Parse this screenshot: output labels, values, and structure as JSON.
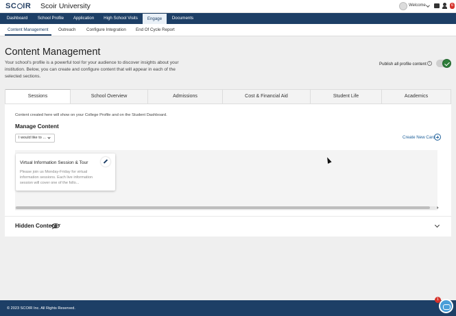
{
  "header": {
    "logo": "SCOIR",
    "org_name": "Scoir University",
    "welcome": "Welcome",
    "notification_count": "6"
  },
  "main_nav": [
    "Dashboard",
    "School Profile",
    "Application",
    "High School Visits",
    "Engage",
    "Documents"
  ],
  "main_nav_active": "Engage",
  "sub_nav": [
    "Content Management",
    "Outreach",
    "Configure Integration",
    "End Of Cycle Report"
  ],
  "sub_nav_active": "Content Management",
  "page": {
    "title": "Content Management",
    "intro": "Your school's profile is a powerful tool for your audience to discover insights about your institution. Below, you can create and configure content that will appear in each of the selected sections.",
    "publish_label": "Publish all profile content",
    "publish_enabled": true
  },
  "content_tabs": [
    "Sessions",
    "School Overview",
    "Admissions",
    "Cost & Financial Aid",
    "Student Life",
    "Academics"
  ],
  "content_tab_active": "Sessions",
  "panel": {
    "note": "Content created here will show on your College Profile and on the Student Dashboard.",
    "manage_title": "Manage Content",
    "select_value": "I would like to ...",
    "create_label": "Create New Card",
    "card": {
      "title": "Virtual Information Session & Tour",
      "body": "Please join us Monday-Friday for virtual information sessions. Each live information session will cover one of the follo..."
    },
    "hidden_title": "Hidden Content"
  },
  "footer": {
    "copyright": "© 2023 SCOIR Inc. All Rights Reserved.",
    "chat_badge": "1"
  },
  "colors": {
    "nav_bg": "#1d3f66",
    "accent_green": "#2e7d3a",
    "link_blue": "#1d5f9a"
  }
}
